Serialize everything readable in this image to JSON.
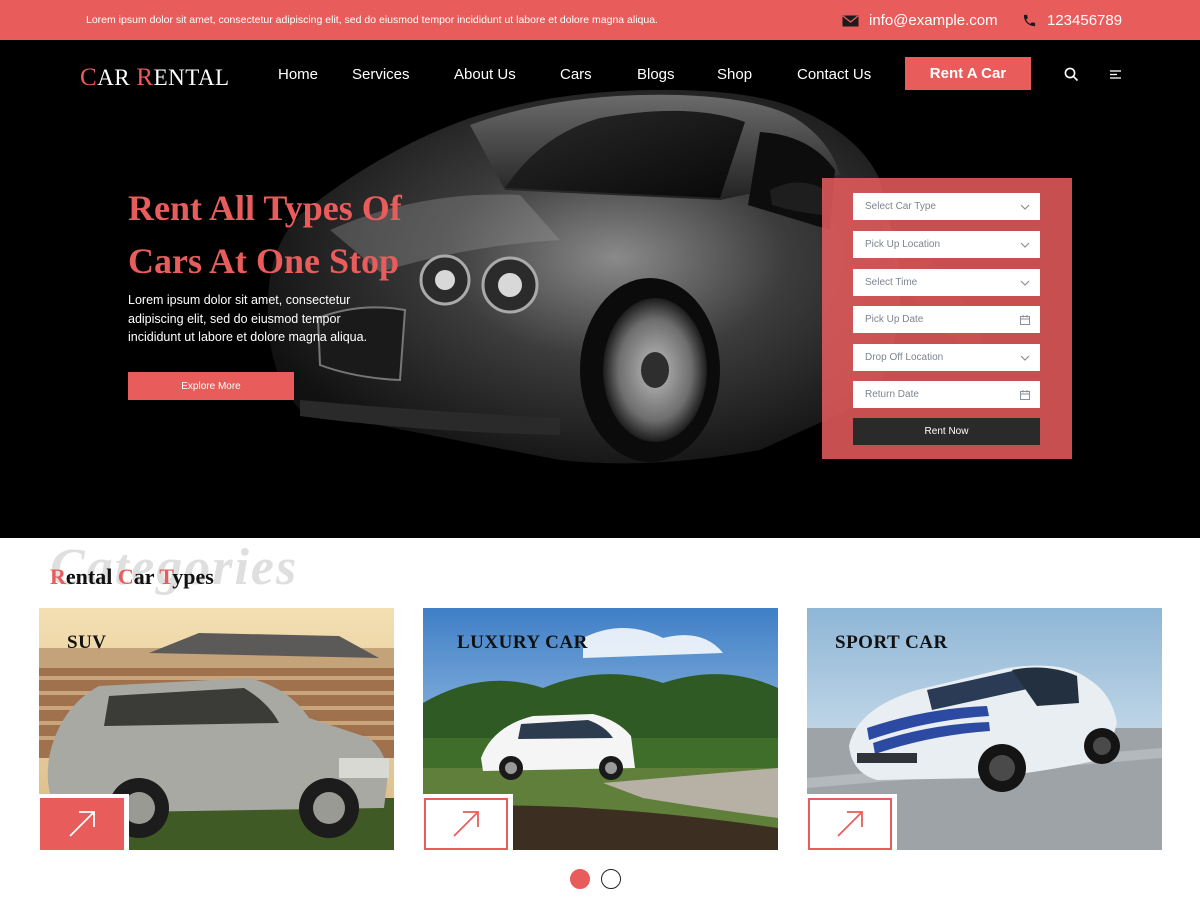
{
  "topbar": {
    "tagline": "Lorem ipsum dolor sit amet, consectetur adipiscing elit, sed do eiusmod tempor incididunt ut labore et dolore magna aliqua.",
    "email": "info@example.com",
    "phone": "123456789"
  },
  "brand": {
    "first_cap": "C",
    "first_rest": "AR ",
    "second_cap": "R",
    "second_rest": "ENTAL"
  },
  "nav": {
    "items": [
      "Home",
      "Services",
      "About Us",
      "Cars",
      "Blogs",
      "Shop",
      "Contact Us"
    ],
    "cta": "Rent A Car"
  },
  "hero": {
    "title": "Rent All Types Of Cars At One Stop",
    "text": "Lorem ipsum dolor sit amet, consectetur adipiscing elit, sed do eiusmod tempor incididunt ut labore et dolore magna aliqua.",
    "button": "Explore More"
  },
  "booking": {
    "fields": [
      {
        "placeholder": "Select Car Type",
        "icon": "chevron-down-icon"
      },
      {
        "placeholder": "Pick Up Location",
        "icon": "chevron-down-icon"
      },
      {
        "placeholder": "Select Time",
        "icon": "chevron-down-icon"
      },
      {
        "placeholder": "Pick Up Date",
        "icon": "calendar-icon"
      },
      {
        "placeholder": "Drop Off Location",
        "icon": "chevron-down-icon"
      },
      {
        "placeholder": "Return Date",
        "icon": "calendar-icon"
      }
    ],
    "submit": "Rent Now"
  },
  "categories": {
    "background_word": "Categories",
    "title_parts": [
      "R",
      "ental ",
      "C",
      "ar ",
      "T",
      "ypes"
    ],
    "cards": [
      {
        "label": "SUV"
      },
      {
        "label": "LUXURY CAR"
      },
      {
        "label": "SPORT CAR"
      }
    ],
    "pagination": {
      "pages": 2,
      "active": 1
    }
  },
  "colors": {
    "accent": "#e85c5c",
    "dark": "#000000",
    "button_dark": "#2a2a2a"
  }
}
